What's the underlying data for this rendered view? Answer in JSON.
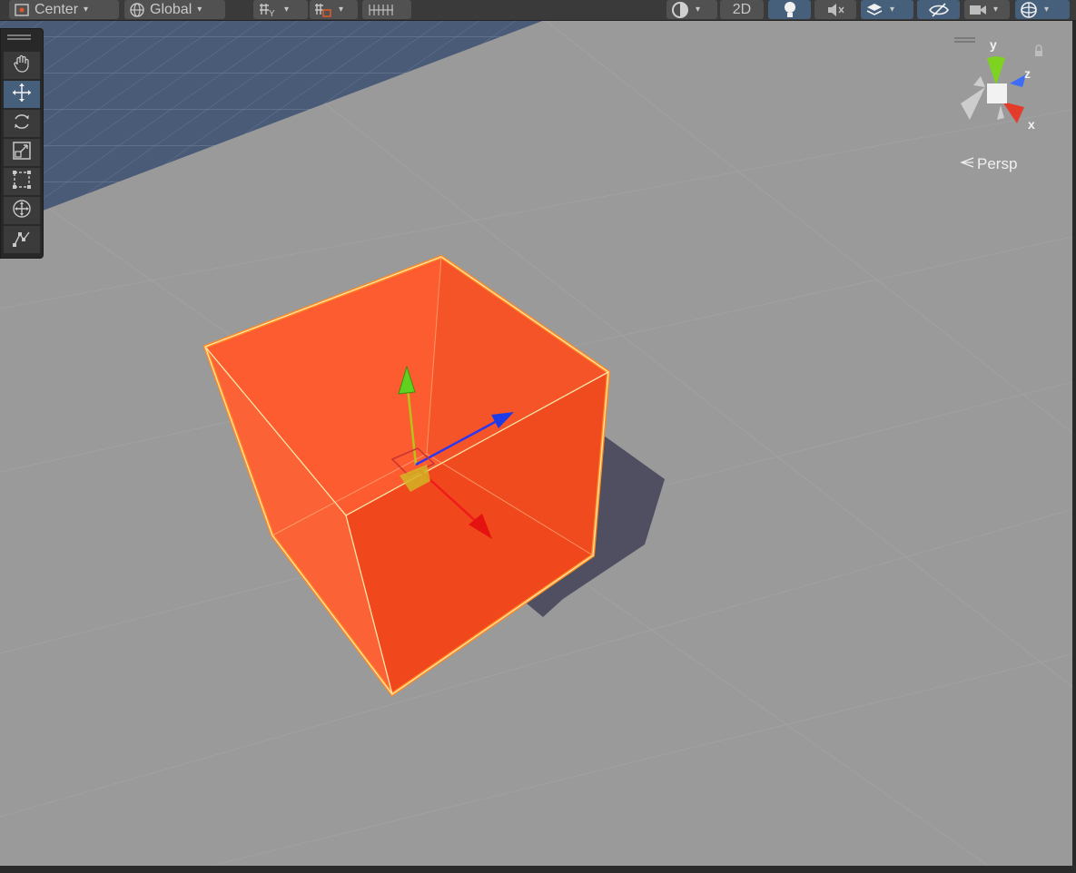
{
  "toolbar": {
    "pivot_mode_label": "Center",
    "pivot_rotation_label": "Global",
    "view_2d_label": "2D",
    "dropdown_glyph": "▾"
  },
  "tools": [
    {
      "name": "hand-tool",
      "icon": "hand-icon",
      "active": false
    },
    {
      "name": "move-tool",
      "icon": "move-icon",
      "active": true
    },
    {
      "name": "rotate-tool",
      "icon": "rotate-icon",
      "active": false
    },
    {
      "name": "scale-tool",
      "icon": "scale-icon",
      "active": false
    },
    {
      "name": "rect-tool",
      "icon": "rect-transform-icon",
      "active": false
    },
    {
      "name": "transform-tool",
      "icon": "transform-icon",
      "active": false
    },
    {
      "name": "custom-tool",
      "icon": "custom-editor-tool-icon",
      "active": false
    }
  ],
  "gizmo": {
    "axis_y": "y",
    "axis_z": "z",
    "axis_x": "x",
    "projection_label": "Persp"
  },
  "colors": {
    "scene_background": "#9a9a9b",
    "selected_object": "#fd5a2e",
    "selection_outline": "#ff7a1a",
    "axis_x": "#f21d1d",
    "axis_y": "#7ed321",
    "axis_z": "#2a4ef5",
    "active_tool": "#46607c"
  }
}
